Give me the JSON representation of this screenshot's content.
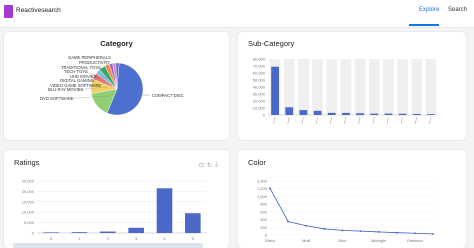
{
  "app": {
    "brand": "Reactivesearch"
  },
  "nav": {
    "explore": "Explore",
    "search": "Search"
  },
  "cards": {
    "category_title": "Category",
    "subcategory_title": "Sub-Category",
    "ratings_title": "Ratings",
    "color_title": "Color"
  },
  "colors": {
    "accent": "#1a73e8",
    "logo": "#a63ad0",
    "bar": "#4a68c7",
    "series_line": "#3a5fb8"
  },
  "icons": [
    "zoom-icon",
    "refresh-icon",
    "download-icon"
  ],
  "chart_data": [
    {
      "type": "pie",
      "title": "Category",
      "labels": [
        "COMPACT DISC",
        "DVD SOFTWARE",
        "VIDEO GAME SOFTWARE",
        "DIGITAL GAMING",
        "UHD MOVIES",
        "BLU-RAY MOVIES",
        "TECH TOYS",
        "TRADITIONAL TOYS",
        "PRODUCTIVITY",
        "GAME PERIPHERALS"
      ],
      "values": [
        55,
        16,
        9,
        4,
        3,
        4,
        3,
        2,
        2,
        2
      ],
      "colors": [
        "#4d6fcf",
        "#8fd073",
        "#f3d061",
        "#ee6a6a",
        "#71c6de",
        "#3aa56a",
        "#f28f4d",
        "#9a63bd",
        "#e47dd2",
        "#5b6ed6"
      ]
    },
    {
      "type": "bar",
      "title": "Sub-Category",
      "categories": [
        "c1",
        "c2",
        "c3",
        "c4",
        "c5",
        "c6",
        "c7",
        "c8",
        "c9",
        "c10",
        "c11",
        "c12"
      ],
      "values": [
        69000,
        11000,
        7000,
        6000,
        3000,
        3000,
        2500,
        2000,
        2000,
        1800,
        1500,
        1200
      ],
      "yticks": [
        "0",
        "10,000",
        "20,000",
        "30,000",
        "40,000",
        "50,000",
        "60,000",
        "70,000",
        "80,000"
      ],
      "ylim": [
        0,
        80000
      ]
    },
    {
      "type": "bar",
      "title": "Ratings",
      "categories": [
        "0",
        "1",
        "2",
        "3",
        "4",
        "5"
      ],
      "values": [
        300,
        400,
        700,
        2500,
        21500,
        9500
      ],
      "yticks": [
        "0",
        "5,000",
        "10,000",
        "15,000",
        "20,000",
        "25,000"
      ],
      "ylim": [
        0,
        25000
      ]
    },
    {
      "type": "line",
      "title": "Color",
      "categories": [
        "Black",
        "",
        "Multi",
        "",
        "Blue",
        "",
        "Midnight",
        "",
        "Platinum",
        ""
      ],
      "values": [
        1210,
        350,
        240,
        160,
        120,
        100,
        80,
        60,
        45,
        30
      ],
      "yticks": [
        "0",
        "200",
        "400",
        "600",
        "800",
        "1,000",
        "1,200",
        "1,400"
      ],
      "ylim": [
        0,
        1400
      ]
    }
  ]
}
